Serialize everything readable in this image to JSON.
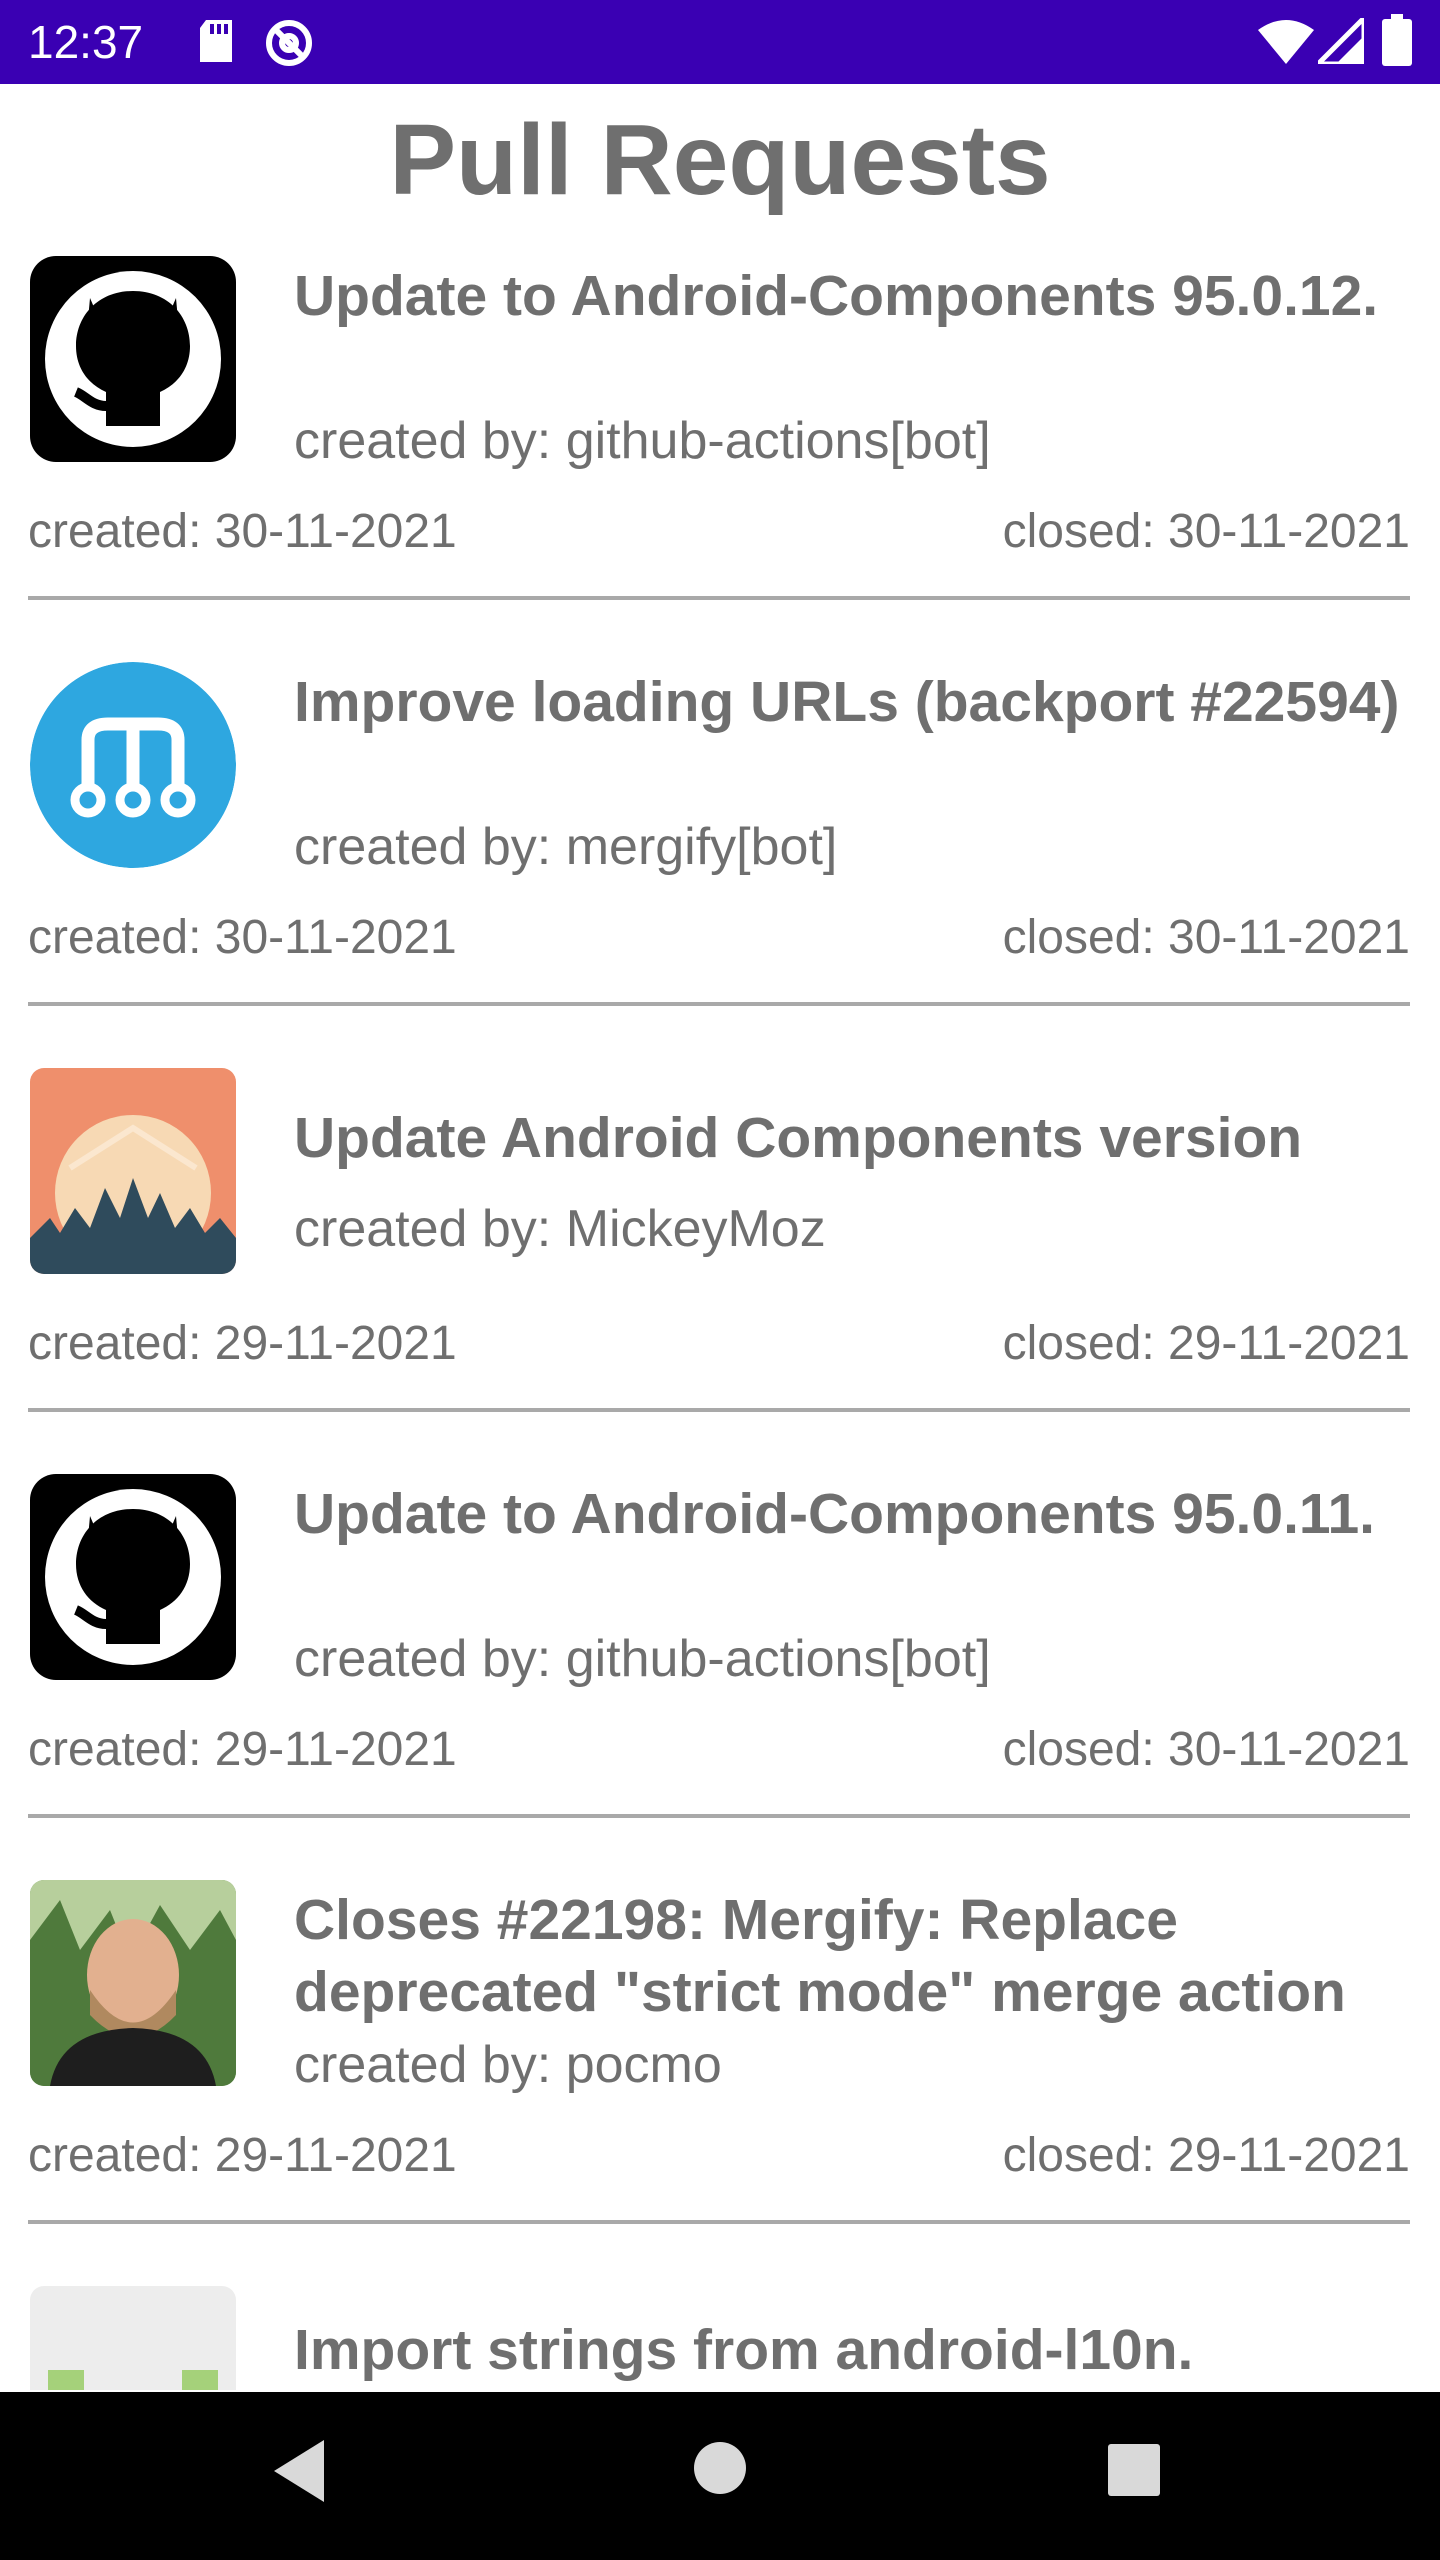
{
  "status_bar": {
    "time": "12:37",
    "icons": [
      "sd-card-icon",
      "at-sign-icon",
      "wifi-icon",
      "signal-icon",
      "battery-icon"
    ]
  },
  "page": {
    "title": "Pull Requests"
  },
  "pull_requests": [
    {
      "title": "Update to Android-Components 95.0.12.",
      "author": "created by: github-actions[bot]",
      "created": "created: 30-11-2021",
      "closed": "closed: 30-11-2021",
      "avatar": "github-octocat-avatar"
    },
    {
      "title": "Improve loading URLs (backport #22594)",
      "author": "created by: mergify[bot]",
      "created": "created: 30-11-2021",
      "closed": "closed: 30-11-2021",
      "avatar": "mergify-avatar"
    },
    {
      "title": "Update Android Components version",
      "author": "created by: MickeyMoz",
      "created": "created: 29-11-2021",
      "closed": "closed: 29-11-2021",
      "avatar": "crowd-sunset-avatar"
    },
    {
      "title": "Update to Android-Components 95.0.11.",
      "author": "created by: github-actions[bot]",
      "created": "created: 29-11-2021",
      "closed": "closed: 30-11-2021",
      "avatar": "github-octocat-avatar"
    },
    {
      "title": "Closes #22198: Mergify: Replace deprecated \"strict mode\" merge action",
      "author": "created by: pocmo",
      "created": "created: 29-11-2021",
      "closed": "closed: 29-11-2021",
      "avatar": "person-photo-avatar"
    },
    {
      "title": "Import strings from android-l10n.",
      "avatar": "identicon-avatar"
    }
  ],
  "colors": {
    "status_bar": "#3a00b3",
    "text": "#6f6f6f",
    "divider": "#a9a9a9",
    "nav_bar": "#000000",
    "mergify_blue": "#2ea7e0"
  },
  "nav_bar": {
    "buttons": [
      "back-icon",
      "home-icon",
      "recents-icon"
    ]
  }
}
